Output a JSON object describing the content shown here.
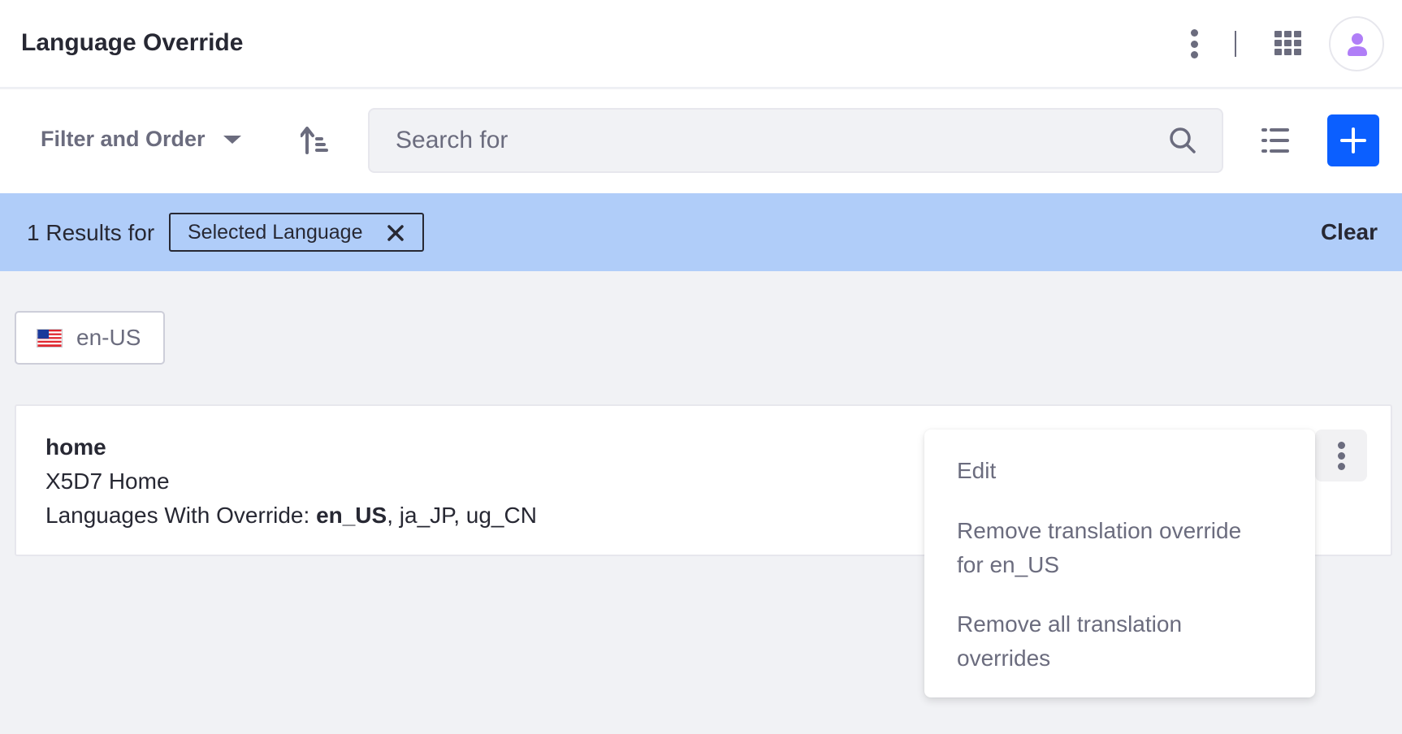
{
  "header": {
    "title": "Language Override",
    "icons": [
      "ellipsis-v-icon",
      "divider",
      "apps-grid-icon",
      "user-avatar-icon"
    ]
  },
  "toolbar": {
    "filter_label": "Filter and Order",
    "sort_icon": "order-arrow-up-icon",
    "search_placeholder": "Search for",
    "search_value": "",
    "view_icon": "list-view-icon",
    "add_icon": "plus-icon"
  },
  "results": {
    "summary": "1 Results for",
    "chip_label": "Selected Language",
    "clear_label": "Clear"
  },
  "language_selector": {
    "label": "en-US",
    "flag": "us-flag-icon"
  },
  "items": [
    {
      "key": "home",
      "value": "X5D7 Home",
      "languages_label": "Languages With Override: ",
      "languages_current": "en_US",
      "languages_rest": ", ja_JP, ug_CN"
    }
  ],
  "actions_menu": {
    "items": [
      {
        "label": "Edit"
      },
      {
        "label": "Remove translation override for en_US"
      },
      {
        "label": "Remove all translation overrides"
      }
    ]
  },
  "colors": {
    "primary": "#0b5fff",
    "results_bar": "#b0cdf9",
    "avatar_accent": "#b07ef7",
    "icon_gray": "#6b6c7e"
  }
}
